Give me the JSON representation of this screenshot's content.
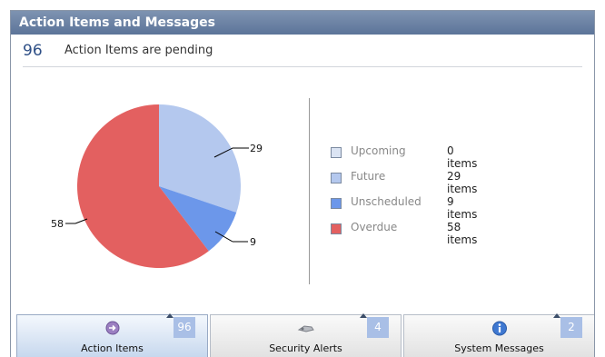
{
  "window": {
    "title": "Action Items and Messages"
  },
  "summary": {
    "count": "96",
    "text": "Action Items are pending"
  },
  "chart_data": {
    "type": "pie",
    "slices": [
      {
        "name": "Upcoming",
        "value": 0,
        "color": "#dbe4f3"
      },
      {
        "name": "Future",
        "value": 29,
        "color": "#b4c8ee"
      },
      {
        "name": "Unscheduled",
        "value": 9,
        "color": "#6c97ea"
      },
      {
        "name": "Overdue",
        "value": 58,
        "color": "#e36060"
      }
    ],
    "data_labels": [
      "29",
      "9",
      "58"
    ]
  },
  "legend": [
    {
      "name": "Upcoming",
      "value_text": "0 items",
      "color": "#dbe4f3"
    },
    {
      "name": "Future",
      "value_text": "29 items",
      "color": "#b4c8ee"
    },
    {
      "name": "Unscheduled",
      "value_text": "9 items",
      "color": "#6c97ea"
    },
    {
      "name": "Overdue",
      "value_text": "58 items",
      "color": "#e36060"
    }
  ],
  "tabs": [
    {
      "label": "Action Items",
      "badge": "96",
      "icon": "arrow-circle-icon",
      "active": true
    },
    {
      "label": "Security Alerts",
      "badge": "4",
      "icon": "security-alert-icon",
      "active": false
    },
    {
      "label": "System Messages",
      "badge": "2",
      "icon": "info-icon",
      "active": false
    }
  ]
}
